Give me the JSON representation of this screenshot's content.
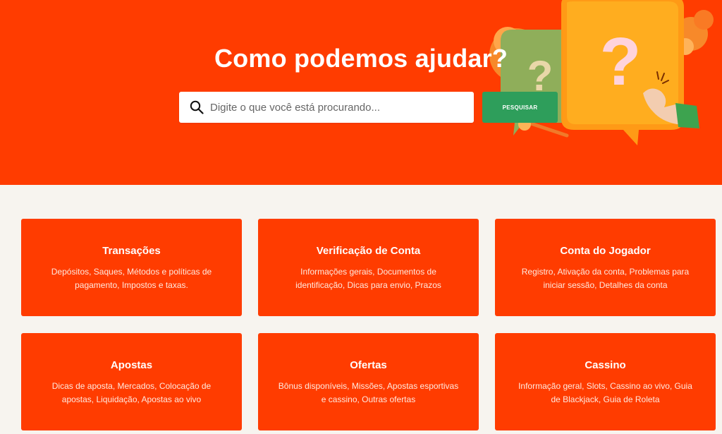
{
  "hero": {
    "title": "Como podemos ajudar?",
    "search_placeholder": "Digite o que você está procurando...",
    "search_button_label": "PESQUISAR",
    "illustration_glyphs": [
      "?",
      "?"
    ]
  },
  "cards": [
    {
      "title": "Transações",
      "description": "Depósitos, Saques, Métodos e políticas de pagamento, Impostos e taxas."
    },
    {
      "title": "Verificação de Conta",
      "description": "Informações gerais, Documentos de identificação, Dicas para envio, Prazos"
    },
    {
      "title": "Conta do Jogador",
      "description": "Registro, Ativação da conta, Problemas para iniciar sessão, Detalhes da conta"
    },
    {
      "title": "Apostas",
      "description": "Dicas de aposta, Mercados, Colocação de apostas, Liquidação, Apostas ao vivo"
    },
    {
      "title": "Ofertas",
      "description": "Bônus disponíveis, Missões, Apostas esportivas e cassino, Outras ofertas"
    },
    {
      "title": "Cassino",
      "description": "Informação geral, Slots, Cassino ao vivo, Guia de Blackjack, Guia de Roleta"
    }
  ],
  "colors": {
    "brand_orange": "#ff3c00",
    "button_green": "#2e9e5b",
    "page_background": "#f7f4ef"
  },
  "icons": {
    "search": "search-icon",
    "illustration": "question-bubbles-illustration"
  }
}
